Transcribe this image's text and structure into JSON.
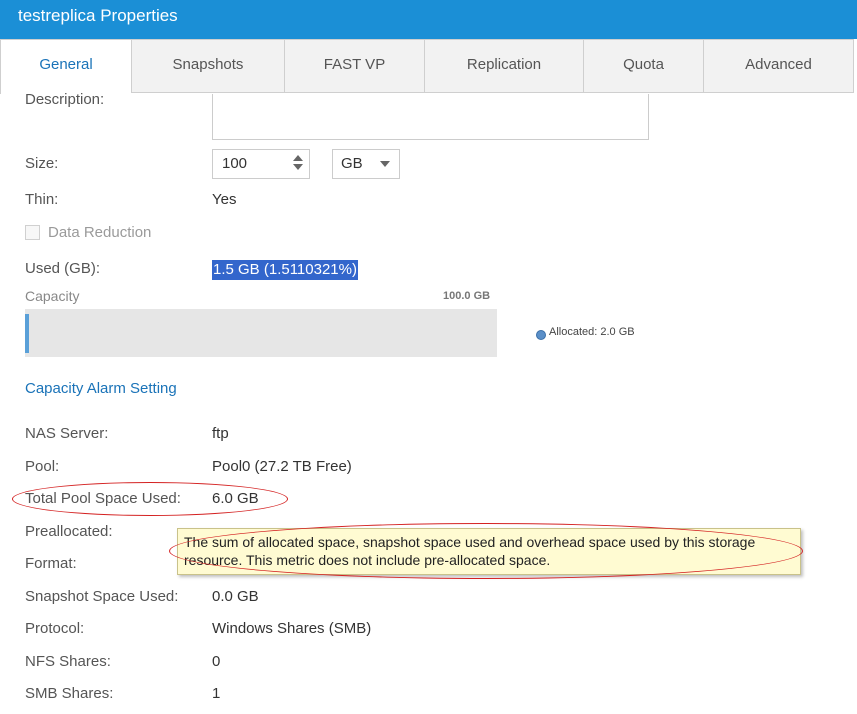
{
  "window": {
    "title": "testreplica Properties"
  },
  "tabs": [
    {
      "label": "General",
      "active": true
    },
    {
      "label": "Snapshots"
    },
    {
      "label": "FAST VP"
    },
    {
      "label": "Replication"
    },
    {
      "label": "Quota"
    },
    {
      "label": "Advanced"
    }
  ],
  "general": {
    "description_label": "Description:",
    "description_value": "",
    "size_label": "Size:",
    "size_value": "100",
    "size_unit": "GB",
    "thin_label": "Thin:",
    "thin_value": "Yes",
    "data_reduction_label": "Data Reduction",
    "data_reduction_checked": false,
    "used_label": "Used (GB):",
    "used_value": "1.5 GB (1.5110321%)",
    "capacity_label": "Capacity",
    "capacity_total": "100.0 GB",
    "capacity_allocated_fraction": 0.02,
    "capacity_legend": "Allocated: 2.0 GB",
    "alarm_link": "Capacity Alarm Setting",
    "nas_label": "NAS Server:",
    "nas_value": "ftp",
    "pool_label": "Pool:",
    "pool_value": "Pool0 (27.2 TB Free)",
    "total_pool_label": "Total Pool Space Used:",
    "total_pool_value": "6.0 GB",
    "preallocated_label": "Preallocated:",
    "format_label": "Format:",
    "snapshot_label": "Snapshot Space Used:",
    "snapshot_value": "0.0 GB",
    "protocol_label": "Protocol:",
    "protocol_value": "Windows Shares (SMB)",
    "nfs_label": "NFS Shares:",
    "nfs_value": "0",
    "smb_label": "SMB Shares:",
    "smb_value": "1"
  },
  "tooltip": {
    "text": "The sum of allocated space, snapshot space used and overhead space used by this storage resource. This metric does not include pre-allocated space."
  },
  "colors": {
    "titlebar": "#1b8fd6",
    "accent": "#1a73b8",
    "highlight": "#3366cc",
    "annotation": "#d42222",
    "tooltip_bg": "#fffbd2"
  }
}
